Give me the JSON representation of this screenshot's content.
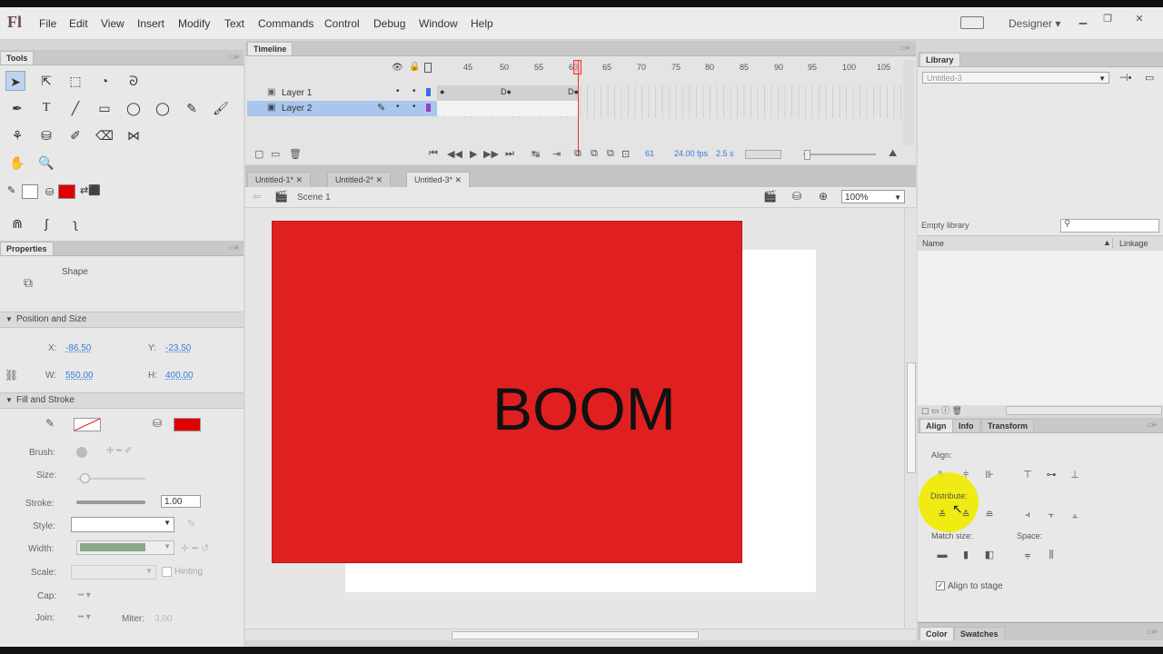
{
  "app": {
    "logo": "Fl",
    "workspace": "Designer"
  },
  "menu": [
    "File",
    "Edit",
    "View",
    "Insert",
    "Modify",
    "Text",
    "Commands",
    "Control",
    "Debug",
    "Window",
    "Help"
  ],
  "tools_panel": {
    "title": "Tools"
  },
  "properties": {
    "title": "Properties",
    "object_type": "Shape",
    "position_size": {
      "header": "Position and Size",
      "x_label": "X:",
      "x": "-86.50",
      "y_label": "Y:",
      "y": "-23.50",
      "w_label": "W:",
      "w": "550.00",
      "h_label": "H:",
      "h": "400.00"
    },
    "fill_stroke": {
      "header": "Fill and Stroke",
      "brush_label": "Brush:",
      "size_label": "Size:",
      "stroke_label": "Stroke:",
      "stroke_value": "1.00",
      "style_label": "Style:",
      "width_label": "Width:",
      "scale_label": "Scale:",
      "hinting_label": "Hinting",
      "cap_label": "Cap:",
      "join_label": "Join:",
      "miter_label": "Miter:",
      "miter_value": "3.00",
      "fill_color": "#e00000"
    }
  },
  "timeline": {
    "title": "Timeline",
    "layers": [
      "Layer 1",
      "Layer 2"
    ],
    "frame_numbers": [
      "45",
      "50",
      "55",
      "60",
      "65",
      "70",
      "75",
      "80",
      "85",
      "90",
      "95",
      "100",
      "105"
    ],
    "status": {
      "frame": "61",
      "fps": "24.00 fps",
      "time": "2.5 s"
    }
  },
  "documents": {
    "tabs": [
      "Untitled-1*",
      "Untitled-2*",
      "Untitled-3*"
    ],
    "scene": "Scene 1",
    "zoom": "100%"
  },
  "stage": {
    "text": "BOOM",
    "rect_color": "#e02020"
  },
  "library": {
    "title": "Library",
    "document": "Untitled-3",
    "empty_label": "Empty library",
    "col_name": "Name",
    "col_linkage": "Linkage"
  },
  "align_panel": {
    "tabs": [
      "Align",
      "Info",
      "Transform"
    ],
    "align_label": "Align:",
    "distribute_label": "Distribute:",
    "match_size_label": "Match size:",
    "space_label": "Space:",
    "align_to_stage_label": "Align to stage"
  },
  "bottom_tabs": [
    "Color",
    "Swatches"
  ]
}
